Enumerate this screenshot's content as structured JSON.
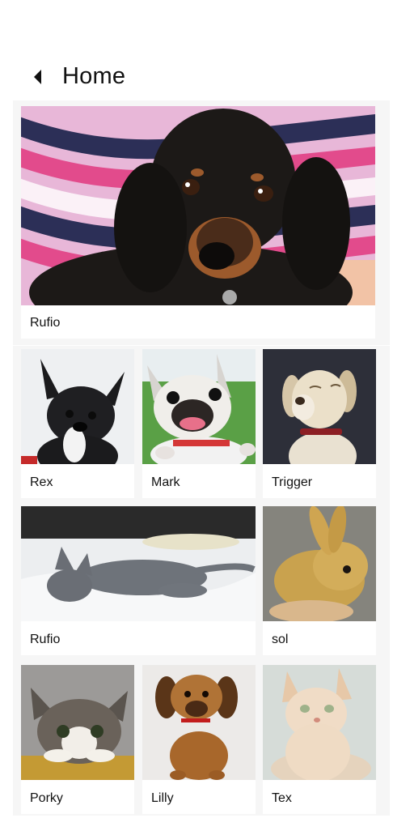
{
  "header": {
    "title": "Home",
    "back_icon": "back-triangle-icon"
  },
  "featured": {
    "name": "Rufio",
    "photo": "black-tan-puppy"
  },
  "grid": [
    {
      "name": "Rex",
      "photo": "black-french-bulldog"
    },
    {
      "name": "Mark",
      "photo": "smiling-pug"
    },
    {
      "name": "Trigger",
      "photo": "yellow-labrador"
    },
    {
      "name": "Rufio",
      "photo": "grey-cat-on-bed"
    },
    {
      "name": "sol",
      "photo": "golden-bunny"
    },
    {
      "name": "Porky",
      "photo": "tabby-kitten"
    },
    {
      "name": "Lilly",
      "photo": "brown-puppy"
    },
    {
      "name": "Tex",
      "photo": "cream-cat"
    }
  ]
}
